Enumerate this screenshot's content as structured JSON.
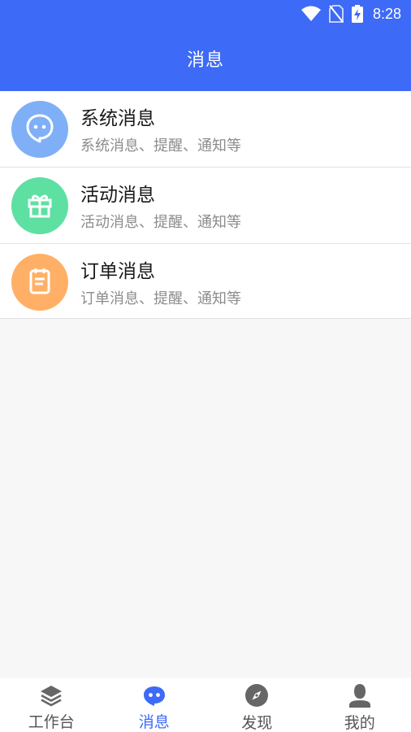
{
  "status_bar": {
    "time": "8:28",
    "icons": [
      "wifi-icon",
      "no-sim-icon",
      "battery-charging-icon"
    ]
  },
  "header": {
    "title": "消息"
  },
  "messages": [
    {
      "title": "系统消息",
      "desc": "系统消息、提醒、通知等",
      "icon": "chat-bubble-icon",
      "color": "#7fb0f7"
    },
    {
      "title": "活动消息",
      "desc": "活动消息、提醒、通知等",
      "icon": "gift-icon",
      "color": "#5ee0a2"
    },
    {
      "title": "订单消息",
      "desc": "订单消息、提醒、通知等",
      "icon": "clipboard-icon",
      "color": "#ffb066"
    }
  ],
  "tabbar": {
    "items": [
      {
        "label": "工作台",
        "icon": "layers-icon"
      },
      {
        "label": "消息",
        "icon": "message-icon",
        "active": true
      },
      {
        "label": "发现",
        "icon": "compass-icon"
      },
      {
        "label": "我的",
        "icon": "user-icon"
      }
    ],
    "active_color": "#3d6af7",
    "inactive_color": "#555555"
  },
  "colors": {
    "brand": "#3d6af7",
    "background": "#f7f7f7"
  }
}
